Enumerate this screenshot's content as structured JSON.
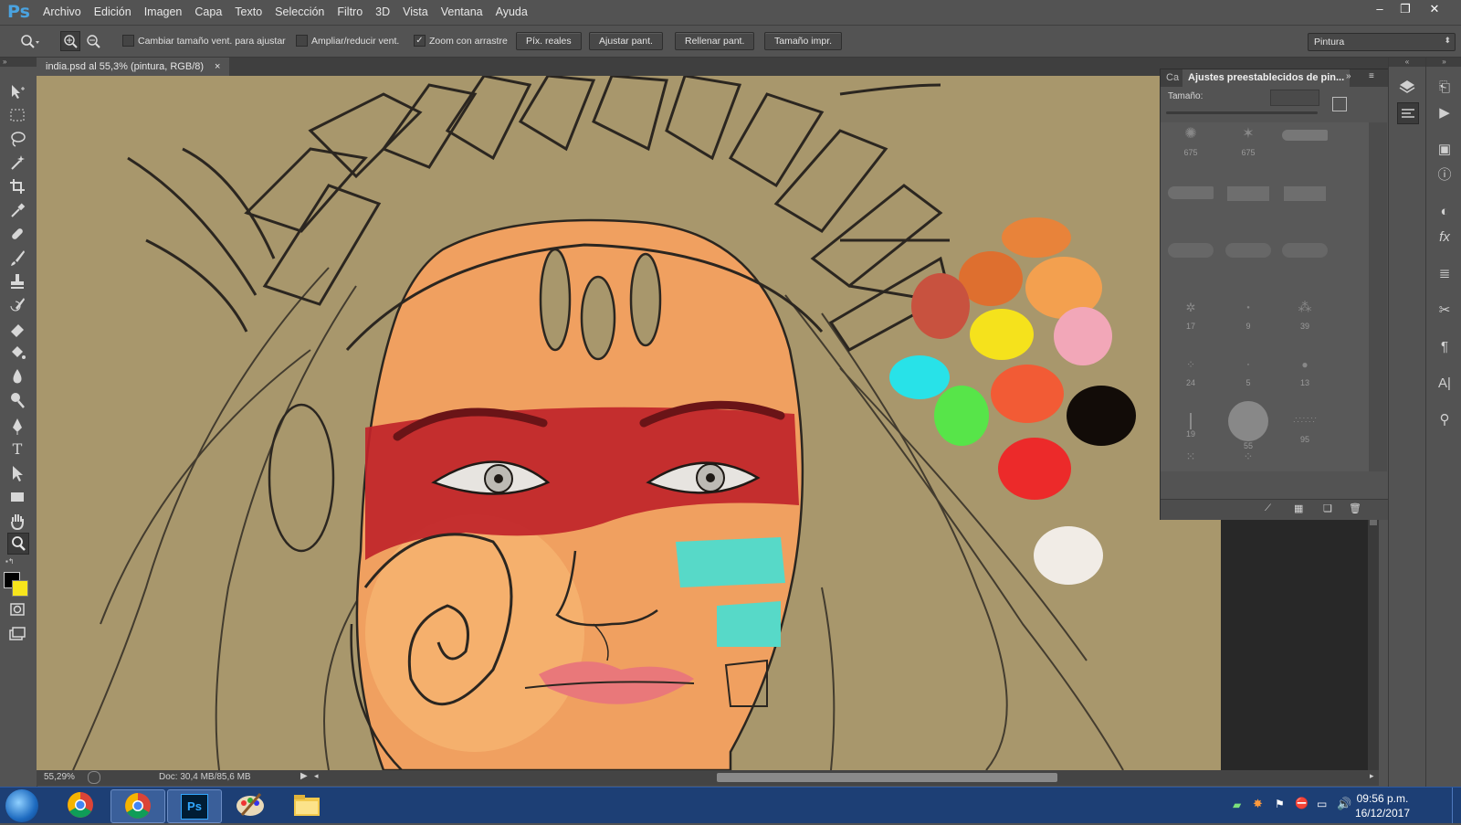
{
  "app": {
    "logo": "Ps"
  },
  "menu": [
    "Archivo",
    "Edición",
    "Imagen",
    "Capa",
    "Texto",
    "Selección",
    "Filtro",
    "3D",
    "Vista",
    "Ventana",
    "Ayuda"
  ],
  "window_controls": {
    "minimize": "–",
    "restore": "❐",
    "close": "✕"
  },
  "options_bar": {
    "resize_windows": {
      "label": "Cambiar tamaño vent. para ajustar",
      "checked": false
    },
    "zoom_all": {
      "label": "Ampliar/reducir vent.",
      "checked": false
    },
    "scrubby_zoom": {
      "label": "Zoom con arrastre",
      "checked": true
    },
    "buttons": [
      "Píx. reales",
      "Ajustar pant.",
      "Rellenar pant.",
      "Tamaño impr."
    ],
    "workspace": "Pintura"
  },
  "document": {
    "tab_title": "india.psd al 55,3% (pintura, RGB/8)",
    "close": "×"
  },
  "status_bar": {
    "zoom": "55,29%",
    "doc": "Doc: 30,4 MB/85,6 MB"
  },
  "brush_panel": {
    "tab_short": "Ca",
    "tab_title": "Ajustes preestablecidos de pin...",
    "size_label": "Tamaño:",
    "brush_sizes": [
      "675",
      "675",
      "",
      "",
      "",
      "",
      "",
      "",
      "",
      "",
      "17",
      "9",
      "39",
      "24",
      "5",
      "13",
      "19",
      "55",
      "95"
    ]
  },
  "palette_swatches": [
    "#e8833a",
    "#de6f2f",
    "#f3a04f",
    "#c8523f",
    "#f5e21c",
    "#f2a7b8",
    "#28e2e8",
    "#f25b35",
    "#57e549",
    "#120c08",
    "#ec2a2a",
    "#f1ece6"
  ],
  "taskbar": {
    "time": "09:56 p.m.",
    "date": "16/12/2017"
  },
  "colors": {
    "foreground": "#000000",
    "background": "#f7e51c",
    "canvas": "#a8976c",
    "skin": "#f0a060",
    "warpaint": "#c0242a"
  }
}
